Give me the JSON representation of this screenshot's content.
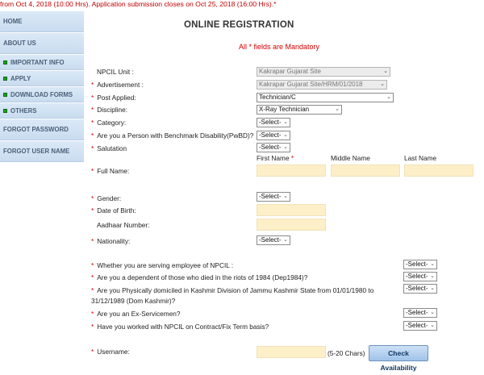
{
  "ticker": "from Oct 4, 2018 (10:00 Hrs). Application submission closes on Oct 25, 2018 (16:00 Hrs).*",
  "sidebar": {
    "items": [
      {
        "label": "HOME",
        "bullet": false
      },
      {
        "label": "ABOUT US",
        "bullet": false
      },
      {
        "label": "IMPORTANT INFO",
        "bullet": true
      },
      {
        "label": "APPLY",
        "bullet": true
      },
      {
        "label": "DOWNLOAD FORMS",
        "bullet": true
      },
      {
        "label": "OTHERS",
        "bullet": true
      },
      {
        "label": "FORGOT PASSWORD",
        "bullet": false
      },
      {
        "label": "FORGOT USER NAME",
        "bullet": false
      }
    ]
  },
  "form": {
    "title": "ONLINE REGISTRATION",
    "mandatory_note": "All * fields are Mandatory",
    "star": "*",
    "npcil_unit": {
      "label": "NPCIL Unit :",
      "value": "Kakrapar Gujarat Site"
    },
    "advertisement": {
      "label": "Advertisement :",
      "value": "Kakrapar Gujarat Site/HRM/01/2018"
    },
    "post_applied": {
      "label": "Post Applied:",
      "value": "Technician/C"
    },
    "discipline": {
      "label": "Discipline:",
      "value": "X-Ray Technician"
    },
    "category": {
      "label": "Category:",
      "value": "-Select-"
    },
    "pwbd": {
      "label": "Are you a Person with Benchmark Disability(PwBD)?",
      "value": "-Select-"
    },
    "salutation": {
      "label": "Salutation",
      "value": "-Select-"
    },
    "name_headers": {
      "first": "First Name",
      "middle": "Middle Name",
      "last": "Last Name"
    },
    "full_name": {
      "label": "Full Name:"
    },
    "gender": {
      "label": "Gender:",
      "value": "-Select-"
    },
    "dob": {
      "label": "Date of Birth:"
    },
    "aadhaar": {
      "label": "Aadhaar Number:"
    },
    "nationality": {
      "label": "Nationality:",
      "value": "-Select-"
    },
    "npcil_employee": {
      "label": "Whether you are serving employee of NPCIL :",
      "value": "-Select-"
    },
    "riots_dependent": {
      "label": "Are you a dependent of those who died in the riots of 1984 (Dep1984)?",
      "value": "-Select-"
    },
    "kashmir": {
      "label_line1": "Are you Physically domiciled in Kashmir Division of Jammu Kashmir    State from 01/01/1980 to",
      "label_line2": "31/12/1989 (Dom Kashmir)?",
      "value": "-Select-"
    },
    "ex_servicemen": {
      "label": "Are you an Ex-Servicemen?",
      "value": "-Select-"
    },
    "contract": {
      "label": "Have you worked with NPCIL on Contract/Fix Term basis?",
      "value": "-Select-"
    },
    "username": {
      "label": "Username:",
      "hint": "(5-20 Chars)",
      "button": "Check Availability"
    }
  }
}
